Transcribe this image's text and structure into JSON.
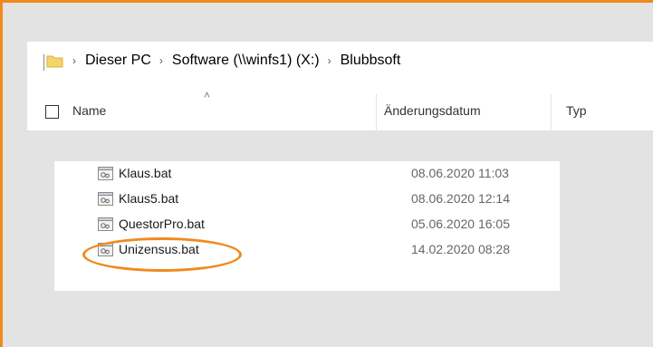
{
  "address_bar": {
    "folder_icon": "folder-icon",
    "breadcrumb": [
      "Dieser PC",
      "Software (\\\\winfs1) (X:)",
      "Blubbsoft"
    ]
  },
  "columns": {
    "name": "Name",
    "date_modified": "Änderungsdatum",
    "type": "Typ"
  },
  "files": [
    {
      "name": "Klaus.bat",
      "date": "08.06.2020 11:03",
      "icon": "batch-file-icon"
    },
    {
      "name": "Klaus5.bat",
      "date": "08.06.2020 12:14",
      "icon": "batch-file-icon"
    },
    {
      "name": "QuestorPro.bat",
      "date": "05.06.2020 16:05",
      "icon": "batch-file-icon"
    },
    {
      "name": "Unizensus.bat",
      "date": "14.02.2020 08:28",
      "icon": "batch-file-icon",
      "highlighted": true
    }
  ],
  "colors": {
    "highlight": "#f08a1c",
    "frame": "#f08a1c"
  }
}
